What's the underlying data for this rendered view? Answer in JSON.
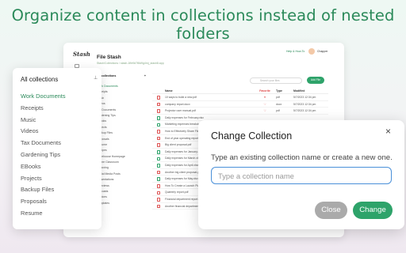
{
  "headline": "Organize content in collections instead of nested folders",
  "app": {
    "logo": "Stash",
    "title": "File Stash",
    "subtitle": "Stash/Collections / stash-1fbt9d7f8d9g4mj_stash8.app",
    "help": "Help & How-To",
    "user": "Chapper",
    "collections_header": "All collections",
    "collections": [
      "Work Documents",
      "Receipts",
      "Music",
      "Videos",
      "Tax Documents",
      "Gardening Tips",
      "EBooks",
      "Projects",
      "Backup Files",
      "Proposals",
      "Resume",
      "Recipes",
      "Warehouse Homepage",
      "Online Classroom",
      "Unboxing",
      "Social Media Posts",
      "Presentations",
      "Interviews",
      "Podcasts",
      "Invoices",
      "Templates"
    ],
    "search_placeholder": "Search your files",
    "add_file": "Add File",
    "columns": [
      "Name",
      "Favorite",
      "Type",
      "Modified"
    ],
    "files": [
      {
        "name": "10 ways to build a new.pdf",
        "fav": "♥",
        "type": "pdf",
        "mod": "5/7/2023 12:34 pm",
        "icon": "red"
      },
      {
        "name": "company report.docx",
        "fav": "♡",
        "type": "docx",
        "mod": "5/7/2023 12:34 pm",
        "icon": "red"
      },
      {
        "name": "Projector user manual.pdf",
        "fav": "♡",
        "type": "pdf",
        "mod": "5/7/2023 12:34 pm",
        "icon": "red"
      },
      {
        "name": "Daily expenses for February.xlsx",
        "fav": "",
        "type": "",
        "mod": "",
        "icon": "green"
      },
      {
        "name": "Marketing expenses breakdown.xlsx",
        "fav": "",
        "type": "",
        "mod": "",
        "icon": "green"
      },
      {
        "name": "How to Effectively Share Files.pdf",
        "fav": "",
        "type": "",
        "mod": "",
        "icon": "red"
      },
      {
        "name": "End of year operating report.pdf",
        "fav": "",
        "type": "",
        "mod": "",
        "icon": "red"
      },
      {
        "name": "Big client proposal.pdf",
        "fav": "",
        "type": "",
        "mod": "",
        "icon": "red"
      },
      {
        "name": "Daily expenses for January.xlsx",
        "fav": "",
        "type": "",
        "mod": "",
        "icon": "green"
      },
      {
        "name": "Daily expenses for March.xlsx",
        "fav": "",
        "type": "",
        "mod": "",
        "icon": "green"
      },
      {
        "name": "Daily expenses for April.xlsx",
        "fav": "",
        "type": "",
        "mod": "",
        "icon": "green"
      },
      {
        "name": "Another big client proposal.pdf",
        "fav": "",
        "type": "",
        "mod": "",
        "icon": "red"
      },
      {
        "name": "Daily expenses for May.xlsx",
        "fav": "",
        "type": "",
        "mod": "",
        "icon": "green"
      },
      {
        "name": "How To Create a Launch Plan.pdf",
        "fav": "",
        "type": "",
        "mod": "",
        "icon": "red"
      },
      {
        "name": "Quarterly report.pdf",
        "fav": "",
        "type": "",
        "mod": "",
        "icon": "red"
      },
      {
        "name": "Financial department report.pdf",
        "fav": "",
        "type": "",
        "mod": "",
        "icon": "red"
      },
      {
        "name": "Another financial department report.pdf",
        "fav": "",
        "type": "",
        "mod": "",
        "icon": "red"
      }
    ]
  },
  "collections_panel": {
    "title": "All collections",
    "items": [
      "Work Documents",
      "Receipts",
      "Music",
      "Videos",
      "Tax Documents",
      "Gardening Tips",
      "EBooks",
      "Projects",
      "Backup Files",
      "Proposals",
      "Resume"
    ],
    "active_index": 0
  },
  "dialog": {
    "title": "Change Collection",
    "close_icon": "×",
    "prompt": "Type an existing collection name or create a new one.",
    "input_placeholder": "Type a collection name",
    "input_value": "",
    "close_label": "Close",
    "change_label": "Change"
  },
  "colors": {
    "accent": "#2b8a5a",
    "button_green": "#2ea36a",
    "button_grey": "#aaaaaa",
    "input_focus": "#4a90d9"
  }
}
